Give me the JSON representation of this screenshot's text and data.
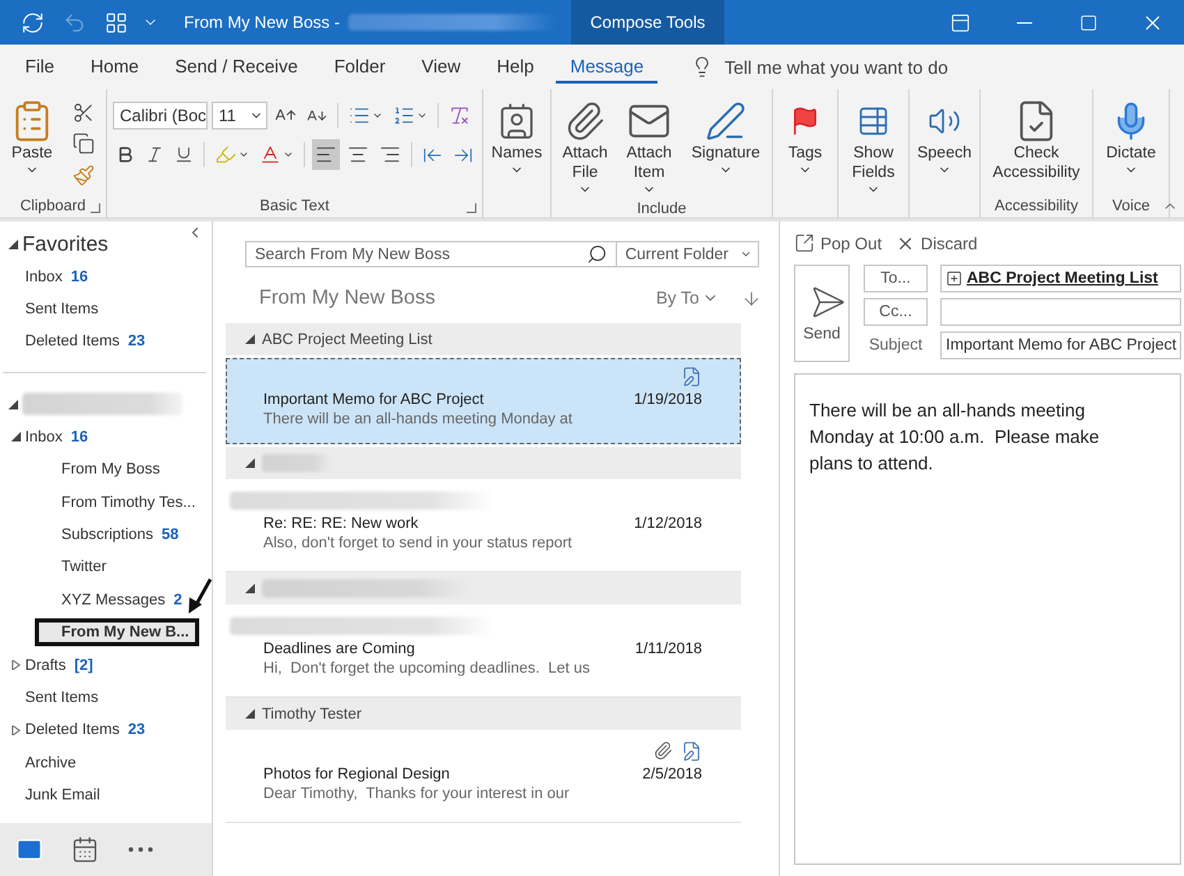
{
  "title_bar": {
    "title": "From My New Boss -",
    "title_redacted": true,
    "context_tab": "Compose Tools",
    "undo_disabled": true
  },
  "menu_tabs": [
    {
      "label": "File",
      "selected": false
    },
    {
      "label": "Home",
      "selected": false
    },
    {
      "label": "Send / Receive",
      "selected": false
    },
    {
      "label": "Folder",
      "selected": false
    },
    {
      "label": "View",
      "selected": false
    },
    {
      "label": "Help",
      "selected": false
    },
    {
      "label": "Message",
      "selected": true
    }
  ],
  "tell_me": {
    "placeholder": "Tell me what you want to do"
  },
  "ribbon": {
    "groups": [
      {
        "kind": "clipboard",
        "label": "Clipboard",
        "launcher": true,
        "buttons": [
          {
            "label": "Paste",
            "dropdown": true
          }
        ]
      },
      {
        "kind": "basic_text",
        "label": "Basic Text",
        "launcher": true,
        "font": "Calibri (Boc",
        "size": "11",
        "alignment": [
          {
            "selected": true
          },
          {
            "selected": false
          },
          {
            "selected": false
          }
        ]
      },
      {
        "kind": "large",
        "buttons": [
          {
            "label": "Names",
            "dropdown": true
          }
        ]
      },
      {
        "kind": "large",
        "label": "Include",
        "buttons": [
          {
            "label": "Attach File",
            "dropdown": true
          },
          {
            "label": "Attach Item",
            "dropdown": true
          },
          {
            "label": "Signature",
            "dropdown": true
          }
        ]
      },
      {
        "kind": "large",
        "buttons": [
          {
            "label": "Tags",
            "dropdown": true
          }
        ]
      },
      {
        "kind": "large",
        "buttons": [
          {
            "label": "Show Fields",
            "dropdown": true
          }
        ]
      },
      {
        "kind": "large",
        "buttons": [
          {
            "label": "Speech",
            "dropdown": true
          }
        ]
      },
      {
        "kind": "large",
        "label": "Accessibility",
        "buttons": [
          {
            "label": "Check Accessibility",
            "dropdown": false
          }
        ]
      },
      {
        "kind": "large",
        "label": "Voice",
        "buttons": [
          {
            "label": "Dictate",
            "dropdown": true
          }
        ]
      }
    ]
  },
  "folder_pane": {
    "favorites": {
      "label": "Favorites",
      "expanded": true,
      "items": [
        {
          "label": "Inbox",
          "count": "16",
          "selected": false
        },
        {
          "label": "Sent Items",
          "selected": false
        },
        {
          "label": "Deleted Items",
          "count": "23",
          "selected": false
        }
      ]
    },
    "account": {
      "expanded": true,
      "name_redacted": true,
      "folders": [
        {
          "label": "Inbox",
          "count": "16",
          "expanded": true,
          "selected": false,
          "children": [
            {
              "label": "From My Boss",
              "selected": false
            },
            {
              "label": "From Timothy Tes...",
              "selected": false
            },
            {
              "label": "Subscriptions",
              "count": "58",
              "selected": false
            },
            {
              "label": "Twitter",
              "selected": false
            },
            {
              "label": "XYZ Messages",
              "count": "2",
              "selected": false
            },
            {
              "label": "From My New B...",
              "selected": true
            }
          ]
        },
        {
          "label": "Drafts",
          "count": "[2]",
          "expanded": false,
          "selected": false
        },
        {
          "label": "Sent Items",
          "selected": false
        },
        {
          "label": "Deleted Items",
          "count": "23",
          "expanded": false,
          "selected": false
        },
        {
          "label": "Archive",
          "selected": false
        },
        {
          "label": "Junk Email",
          "selected": false
        }
      ]
    },
    "bottom_nav": [
      {
        "selected": true
      },
      {
        "selected": false
      },
      {
        "selected": false
      }
    ]
  },
  "message_list": {
    "search": {
      "placeholder": "Search From My New Boss"
    },
    "scope": "Current Folder",
    "folder_title": "From My New Boss",
    "sort": "By To",
    "groups": [
      {
        "label": "ABC Project Meeting List",
        "expanded": true,
        "messages": [
          {
            "subject": "Important Memo for ABC Project",
            "preview": "There will be an all-hands meeting Monday at",
            "date": "1/19/2018",
            "selected": true,
            "draft": true,
            "attachment": false,
            "sender_redacted": false
          }
        ]
      },
      {
        "expanded": true,
        "messages": [
          {
            "subject": "Re: RE: RE: New work",
            "preview": "Also, don't forget to send in your status report",
            "date": "1/12/2018",
            "selected": false,
            "draft": false,
            "attachment": false,
            "sender_redacted": true
          }
        ]
      },
      {
        "expanded": true,
        "messages": [
          {
            "subject": "Deadlines are Coming",
            "preview": "Hi,  Don't forget the upcoming deadlines.  Let us",
            "date": "1/11/2018",
            "selected": false,
            "draft": false,
            "attachment": false,
            "sender_redacted": true
          }
        ]
      },
      {
        "label": "Timothy Tester",
        "expanded": true,
        "messages": [
          {
            "subject": "Photos for Regional Design",
            "preview": "Dear Timothy,  Thanks for your interest in our",
            "date": "2/5/2018",
            "selected": false,
            "draft": true,
            "attachment": true,
            "sender_redacted": false
          }
        ]
      }
    ]
  },
  "reading_pane": {
    "pop_out": "Pop Out",
    "discard": "Discard",
    "send": "Send",
    "to_button": "To...",
    "cc_button": "Cc...",
    "subject_label": "Subject",
    "to": [
      {
        "name": "ABC Project Meeting List"
      }
    ],
    "subject": "Important Memo for ABC Project",
    "body": [
      "There will be an all-hands meeting",
      "Monday at 10:00 a.m.  Please make",
      "plans to attend."
    ]
  }
}
